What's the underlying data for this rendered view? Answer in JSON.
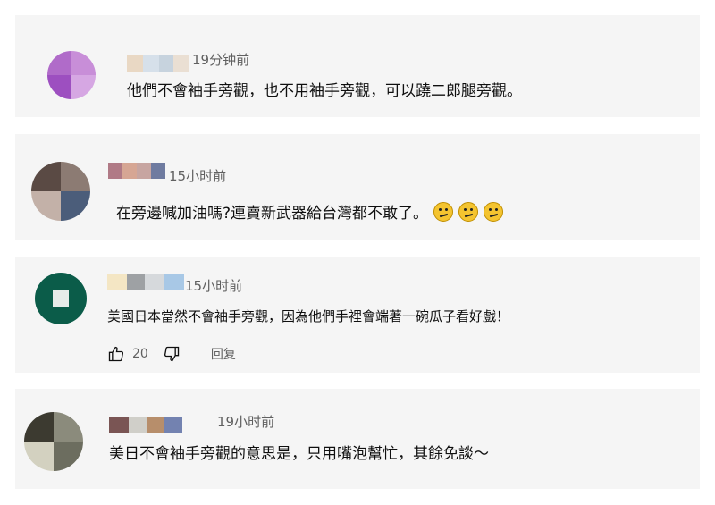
{
  "comments": [
    {
      "time": "19分钟前",
      "text": "他們不會袖手旁觀，也不用袖手旁觀，可以蹺二郎腿旁觀。",
      "avatar_colors": [
        "#b06bc9",
        "#c88ed8",
        "#9d4fc0",
        "#d6a7e3"
      ],
      "name_colors": [
        "#e9d8c4",
        "#d6e0ea",
        "#c7d3de",
        "#eadfd3"
      ]
    },
    {
      "time": "15小时前",
      "text": "在旁邊喊加油嗎?連賣新武器給台灣都不敢了。",
      "emoji": [
        "confused-face-icon",
        "confused-face-icon",
        "confused-face-icon"
      ],
      "avatar_colors": [
        "#5a4a44",
        "#8c7b73",
        "#c3b1a8",
        "#4b5d7a"
      ],
      "name_colors": [
        "#b07a86",
        "#d6a694",
        "#c7a5a1",
        "#6f7ba0"
      ]
    },
    {
      "time": "15小时前",
      "text": "美國日本當然不會袖手旁觀，因為他們手裡會端著一碗瓜子看好戲！",
      "likes": "20",
      "reply_label": "回复",
      "avatar_colors": [
        "#0b5c49",
        "#117358",
        "#e7ece9",
        "#0d624d"
      ],
      "name_colors": [
        "#f4e6c4",
        "#9ea1a4",
        "#d6d9dc",
        "#a8c8e6"
      ]
    },
    {
      "time": "19小时前",
      "text": "美日不會袖手旁觀的意思是，只用嘴泡幫忙，其餘免談～",
      "avatar_colors": [
        "#3c3a30",
        "#8b8b7c",
        "#d3d1c0",
        "#6c6d5f"
      ],
      "name_colors": [
        "#7a5554",
        "#d0cfc9",
        "#b78e6b",
        "#7382b0"
      ]
    }
  ]
}
